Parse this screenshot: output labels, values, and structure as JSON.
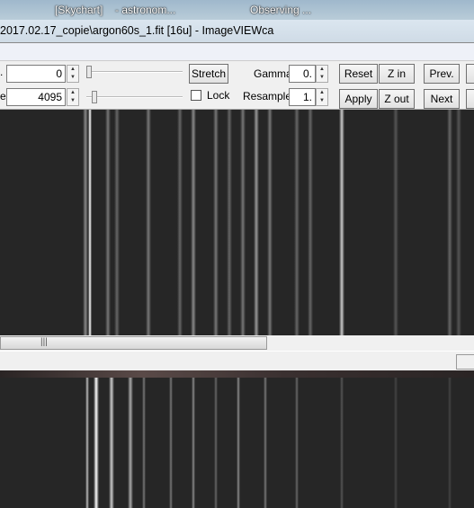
{
  "taskbar": {
    "items": [
      "[Skychart]",
      "- astronom...",
      "Observing ..."
    ]
  },
  "window": {
    "title": "2017.02.17_copie\\argon60s_1.fit [16u] - ImageVIEWca"
  },
  "toolbar": {
    "min_value": "0",
    "max_value": "4095",
    "min_label_fragment": ".",
    "max_label_fragment": "e",
    "stretch": "Stretch",
    "lock": "Lock",
    "lock_checked": false,
    "gamma_label": "Gamma",
    "gamma_value": "0.",
    "resample_label": "Resample",
    "resample_value": "1.",
    "reset": "Reset",
    "apply": "Apply",
    "zoom_in": "Z in",
    "zoom_out": "Z out",
    "prev": "Prev.",
    "next": "Next"
  },
  "scrollbar": {
    "grip": "|||"
  }
}
